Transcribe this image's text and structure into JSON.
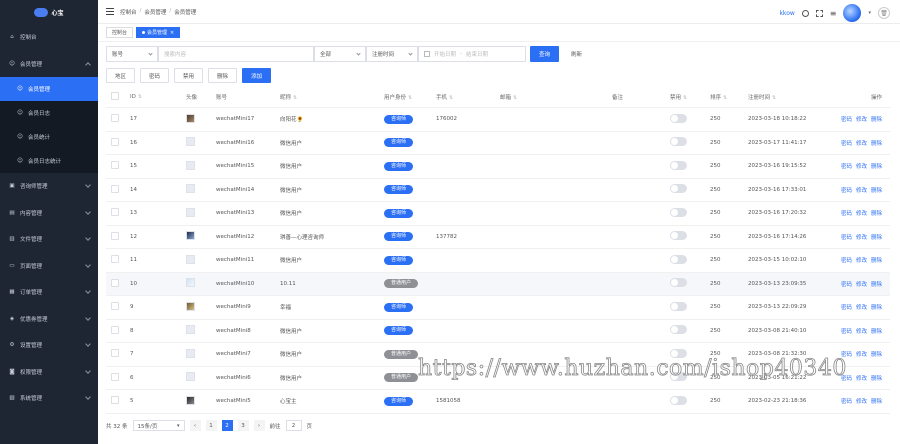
{
  "logo": {
    "text": "心宝"
  },
  "sidebar": {
    "items": [
      {
        "label": "控制台",
        "icon": "home-icon"
      },
      {
        "label": "会员管理",
        "icon": "user-icon",
        "open": true,
        "children": [
          {
            "label": "会员管理",
            "active": true
          },
          {
            "label": "会员日志"
          },
          {
            "label": "会员统计"
          },
          {
            "label": "会员日志统计"
          }
        ]
      },
      {
        "label": "咨询师管理",
        "icon": "consultant-icon"
      },
      {
        "label": "内容管理",
        "icon": "content-icon"
      },
      {
        "label": "文件管理",
        "icon": "folder-icon"
      },
      {
        "label": "页面管理",
        "icon": "monitor-icon"
      },
      {
        "label": "订单管理",
        "icon": "order-icon"
      },
      {
        "label": "优惠券管理",
        "icon": "coupon-icon"
      },
      {
        "label": "设置管理",
        "icon": "settings-icon"
      },
      {
        "label": "权限管理",
        "icon": "lock-icon"
      },
      {
        "label": "系统管理",
        "icon": "system-icon"
      }
    ]
  },
  "header": {
    "breadcrumb": [
      "控制台",
      "会员管理",
      "会员管理"
    ],
    "user_name": "kkow"
  },
  "tabs": [
    {
      "label": "控制台",
      "active": false
    },
    {
      "label": "会员管理",
      "active": true
    }
  ],
  "filter": {
    "field_select": "账号",
    "search_placeholder": "搜索内容",
    "status_select": "全部",
    "date_type_select": "注册时间",
    "start_placeholder": "开始日期",
    "range_sep": "-",
    "end_placeholder": "结束日期",
    "query_label": "查询",
    "reset_label": "刷新"
  },
  "actions": {
    "region": "地区",
    "password": "密码",
    "disable": "禁用",
    "delete": "删除",
    "add": "添加"
  },
  "table": {
    "columns": {
      "id": "ID",
      "avatar": "头像",
      "account": "账号",
      "nickname": "昵称",
      "identity": "用户身份",
      "phone": "手机",
      "email": "邮箱",
      "remark": "备注",
      "disabled": "禁用",
      "sort": "排序",
      "register_time": "注册时间",
      "ops": "操作"
    },
    "op_labels": {
      "password": "密码",
      "edit": "修改",
      "delete": "删除"
    },
    "rows": [
      {
        "id": "17",
        "avatar": "img",
        "account": "wechatMini17",
        "nickname": "向阳花🌻",
        "identity": "咨询师",
        "identity_type": "blue",
        "phone": "176002",
        "sort": "250",
        "time": "2023-03-18 10:18:22"
      },
      {
        "id": "16",
        "avatar": "blank",
        "account": "wechatMini16",
        "nickname": "微信用户",
        "identity": "咨询师",
        "identity_type": "blue",
        "phone": "",
        "sort": "250",
        "time": "2023-03-17 11:41:17"
      },
      {
        "id": "15",
        "avatar": "blank",
        "account": "wechatMini15",
        "nickname": "微信用户",
        "identity": "咨询师",
        "identity_type": "blue",
        "phone": "",
        "sort": "250",
        "time": "2023-03-16 19:15:52"
      },
      {
        "id": "14",
        "avatar": "blank",
        "account": "wechatMini14",
        "nickname": "微信用户",
        "identity": "咨询师",
        "identity_type": "blue",
        "phone": "",
        "sort": "250",
        "time": "2023-03-16 17:33:01"
      },
      {
        "id": "13",
        "avatar": "blank",
        "account": "wechatMini13",
        "nickname": "微信用户",
        "identity": "咨询师",
        "identity_type": "blue",
        "phone": "",
        "sort": "250",
        "time": "2023-03-16 17:20:32"
      },
      {
        "id": "12",
        "avatar": "img2",
        "account": "wechatMini12",
        "nickname": "琪善—心理咨询师",
        "identity": "咨询师",
        "identity_type": "blue",
        "phone": "137782",
        "sort": "250",
        "time": "2023-03-16 17:14:26"
      },
      {
        "id": "11",
        "avatar": "blank",
        "account": "wechatMini11",
        "nickname": "微信用户",
        "identity": "咨询师",
        "identity_type": "blue",
        "phone": "",
        "sort": "250",
        "time": "2023-03-15 10:02:10"
      },
      {
        "id": "10",
        "avatar": "img3",
        "account": "wechatMini10",
        "nickname": "10.11",
        "identity": "普通用户",
        "identity_type": "grey",
        "phone": "",
        "sort": "250",
        "time": "2023-03-13 23:09:35"
      },
      {
        "id": "9",
        "avatar": "img4",
        "account": "wechatMini9",
        "nickname": "幸福",
        "identity": "咨询师",
        "identity_type": "blue",
        "phone": "",
        "sort": "250",
        "time": "2023-03-13 22:09:29"
      },
      {
        "id": "8",
        "avatar": "blank",
        "account": "wechatMini8",
        "nickname": "微信用户",
        "identity": "咨询师",
        "identity_type": "blue",
        "phone": "",
        "sort": "250",
        "time": "2023-03-08 21:40:10"
      },
      {
        "id": "7",
        "avatar": "blank",
        "account": "wechatMini7",
        "nickname": "微信用户",
        "identity": "普通用户",
        "identity_type": "grey",
        "phone": "",
        "sort": "250",
        "time": "2023-03-08 21:32:30"
      },
      {
        "id": "6",
        "avatar": "blank",
        "account": "wechatMini6",
        "nickname": "微信用户",
        "identity": "普通用户",
        "identity_type": "grey",
        "phone": "",
        "sort": "250",
        "time": "2023-03-05 16:21:22"
      },
      {
        "id": "5",
        "avatar": "img5",
        "account": "wechatMini5",
        "nickname": "心宝主",
        "identity": "咨询师",
        "identity_type": "blue",
        "phone": "1581058",
        "sort": "250",
        "time": "2023-02-23 21:18:36"
      }
    ]
  },
  "pagination": {
    "total": "共 32 条",
    "page_size": "15条/页",
    "prev": "‹",
    "pages": [
      "1",
      "2",
      "3"
    ],
    "active_page": "2",
    "next": "›",
    "goto_label": "前往",
    "goto_value": "2",
    "goto_suffix": "页"
  },
  "watermark": "https://www.huzhan.com/ishop40340",
  "colors": {
    "sidebar_bg": "#1e2633",
    "accent": "#2b6ff5",
    "grey_badge": "#8e9095"
  }
}
